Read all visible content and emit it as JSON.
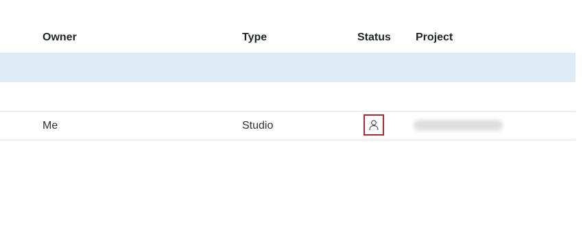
{
  "table": {
    "columns": {
      "owner": "Owner",
      "type": "Type",
      "status": "Status",
      "project": "Project"
    },
    "rows": [
      {
        "owner": "Me",
        "type": "Studio",
        "status_icon": "user-icon",
        "project": ""
      }
    ],
    "colors": {
      "highlight_row": "#dcebf5",
      "status_outline": "#b3272e"
    }
  }
}
